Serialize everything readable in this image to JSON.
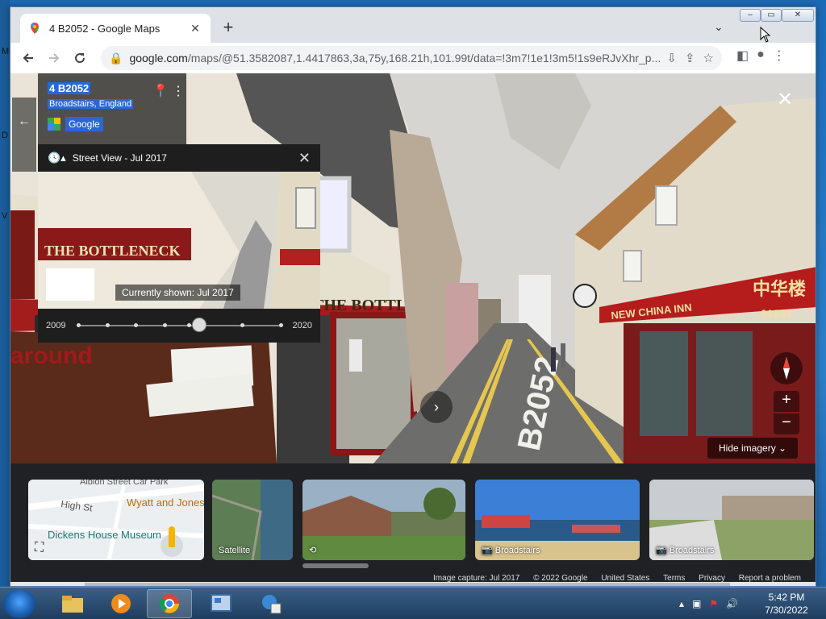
{
  "desktop": {
    "edge_letters": [
      "M",
      "D",
      "V"
    ]
  },
  "browser": {
    "tab_title": "4 B2052 - Google Maps",
    "url_host": "google.com",
    "url_path": "/maps/@51.3582087,1.4417863,3a,75y,168.21h,101.99t/data=!3m7!1e1!3m5!1s9eRJvXhr_p..."
  },
  "maps": {
    "address": "4 B2052",
    "place": "Broadstairs, England",
    "provider": "Google",
    "street_view_title": "Street View - Jul 2017",
    "currently_shown": "Currently shown: Jul 2017",
    "year_start": "2009",
    "year_end": "2020",
    "slider_position": 0.6,
    "hide_imagery": "Hide imagery",
    "scene_text": {
      "pub_name": "THE BOTTLENECK",
      "shop_sign": "NEW CHINA INN",
      "chinese_sign": "中华楼",
      "phone": "01843",
      "road_marking": "B2052",
      "left_sign": "around"
    },
    "thumbnails": [
      {
        "label": "",
        "kind": "map",
        "map_text": [
          "Albion Street Car Park",
          "High St",
          "Wyatt and Jones",
          "Dickens House Museum"
        ]
      },
      {
        "label": "Satellite",
        "kind": "satellite"
      },
      {
        "label": "",
        "kind": "street"
      },
      {
        "label": "Broadstairs",
        "kind": "beach"
      },
      {
        "label": "Broadstairs",
        "kind": "cliff"
      }
    ],
    "footer": {
      "capture": "Image capture: Jul 2017",
      "copyright": "© 2022 Google",
      "country": "United States",
      "terms": "Terms",
      "privacy": "Privacy",
      "report": "Report a problem"
    }
  },
  "taskbar": {
    "time": "5:42 PM",
    "date": "7/30/2022"
  },
  "colors": {
    "highlight": "#2b66d9",
    "taskbar": "#2a4b70"
  }
}
